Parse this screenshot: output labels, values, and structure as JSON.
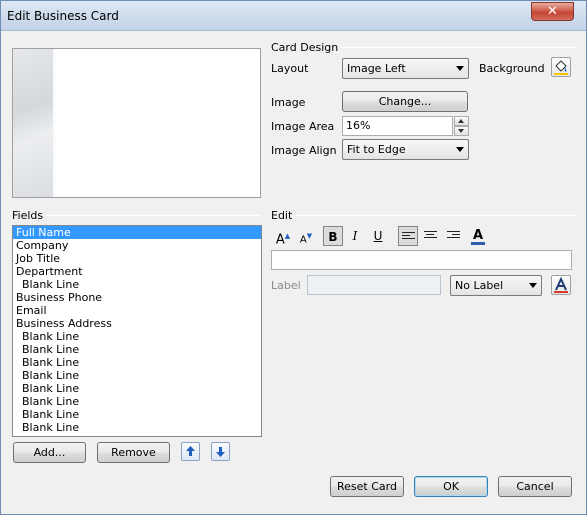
{
  "window": {
    "title": "Edit Business Card",
    "close_glyph": "✕"
  },
  "card_design": {
    "group_label": "Card Design",
    "layout_label": "Layout",
    "layout_value": "Image Left",
    "background_label": "Background",
    "image_label": "Image",
    "change_button": "Change...",
    "image_area_label": "Image Area",
    "image_area_value": "16%",
    "image_align_label": "Image Align",
    "image_align_value": "Fit to Edge"
  },
  "fields": {
    "group_label": "Fields",
    "items": [
      {
        "label": "Full Name",
        "indent": false,
        "selected": true
      },
      {
        "label": "Company",
        "indent": false,
        "selected": false
      },
      {
        "label": "Job Title",
        "indent": false,
        "selected": false
      },
      {
        "label": "Department",
        "indent": false,
        "selected": false
      },
      {
        "label": "Blank Line",
        "indent": true,
        "selected": false
      },
      {
        "label": "Business Phone",
        "indent": false,
        "selected": false
      },
      {
        "label": "Email",
        "indent": false,
        "selected": false
      },
      {
        "label": "Business Address",
        "indent": false,
        "selected": false
      },
      {
        "label": "Blank Line",
        "indent": true,
        "selected": false
      },
      {
        "label": "Blank Line",
        "indent": true,
        "selected": false
      },
      {
        "label": "Blank Line",
        "indent": true,
        "selected": false
      },
      {
        "label": "Blank Line",
        "indent": true,
        "selected": false
      },
      {
        "label": "Blank Line",
        "indent": true,
        "selected": false
      },
      {
        "label": "Blank Line",
        "indent": true,
        "selected": false
      },
      {
        "label": "Blank Line",
        "indent": true,
        "selected": false
      },
      {
        "label": "Blank Line",
        "indent": true,
        "selected": false
      }
    ],
    "add_button": "Add...",
    "remove_button": "Remove"
  },
  "edit": {
    "group_label": "Edit",
    "grow_font_glyph": "A",
    "shrink_font_glyph": "A",
    "bold_glyph": "B",
    "italic_glyph": "I",
    "underline_glyph": "U",
    "font_color_glyph": "A",
    "text_value": "",
    "label_label": "Label",
    "label_value": "",
    "label_position_value": "No Label"
  },
  "footer": {
    "reset_button": "Reset Card",
    "ok_button": "OK",
    "cancel_button": "Cancel"
  },
  "colors": {
    "selection": "#3399ff",
    "title_bar": "#cfdcec",
    "close_button": "#c44533",
    "font_color_bar": "#2f5fa8"
  }
}
